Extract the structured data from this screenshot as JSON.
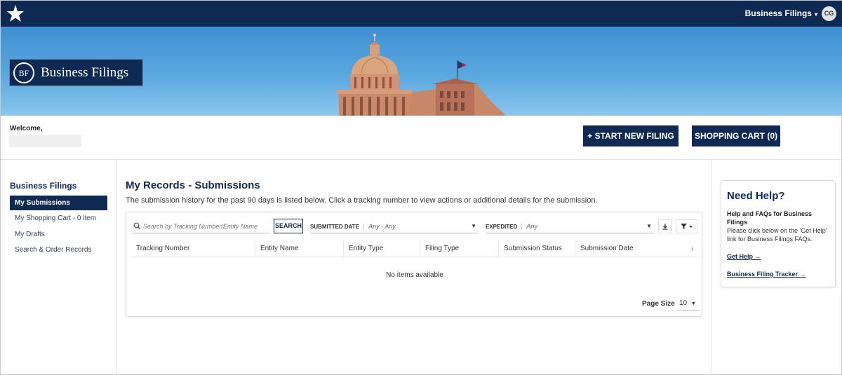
{
  "topbar": {
    "menu_label": "Business Filings",
    "menu_caret": "▾",
    "avatar_initials": "CG"
  },
  "hero": {
    "logo_mark": "BF",
    "logo_text": "Business Filings"
  },
  "welcome": {
    "label": "Welcome,",
    "new_filing_label": "+ START NEW FILING",
    "cart_label": "SHOPPING CART (0)"
  },
  "sidebar": {
    "title": "Business Filings",
    "items": [
      {
        "label": "My Submissions",
        "active": true
      },
      {
        "label": "My Shopping Cart - 0 item"
      },
      {
        "label": "My Drafts"
      },
      {
        "label": "Search & Order Records"
      }
    ]
  },
  "main": {
    "title": "My Records - Submissions",
    "description": "The submission history for the past 90 days is listed below. Click a tracking number to view actions or additional details for the submission.",
    "search_placeholder": "Search by Tracking Number/Entity Name",
    "search_button": "SEARCH",
    "filters": {
      "submitted_label": "SUBMITTED DATE",
      "submitted_value": "Any - Any",
      "expedited_label": "EXPEDITED",
      "expedited_value": "Any"
    },
    "columns": [
      "Tracking Number",
      "Entity Name",
      "Entity Type",
      "Filing Type",
      "Submission Status",
      "Submission Date"
    ],
    "sort_icon": "↓",
    "empty_message": "No items available",
    "page_size_label": "Page Size",
    "page_size_value": "10"
  },
  "help": {
    "title": "Need Help?",
    "subtitle": "Help and FAQs for Business Filings",
    "description": "Please click below on the 'Get Help' link for Business Filings FAQs.",
    "get_help_link": "Get Help →",
    "tracker_link": "Business Filing Tracker →"
  },
  "colors": {
    "navy": "#0f2a52",
    "sky": "#5aa8df"
  }
}
